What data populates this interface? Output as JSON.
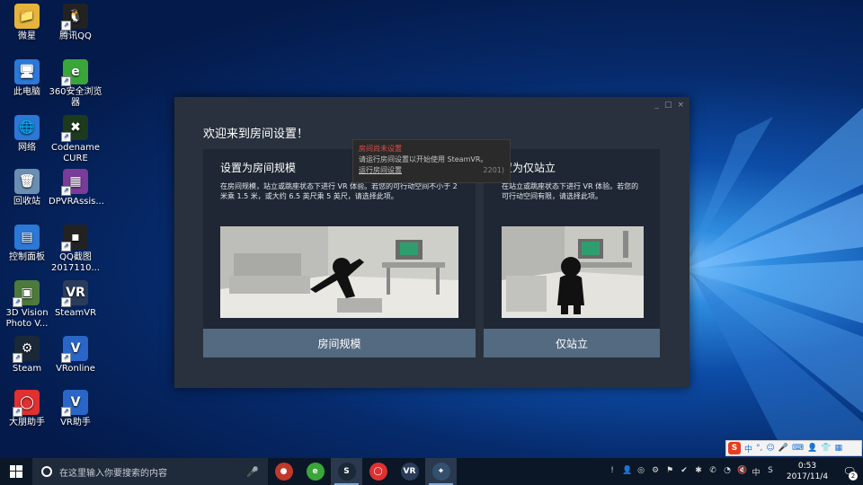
{
  "desktop": {
    "icons": [
      {
        "label": "微星",
        "glyph": "📁",
        "color": "#e7b43b"
      },
      {
        "label": "腾讯QQ",
        "glyph": "🐧",
        "color": "#222222"
      },
      {
        "label": "此电脑",
        "glyph": "🖥",
        "color": "#2b78d6"
      },
      {
        "label": "360安全浏览器",
        "glyph": "e",
        "color": "#3aa63a"
      },
      {
        "label": "网络",
        "glyph": "🌐",
        "color": "#2b78d6"
      },
      {
        "label": "Codename CURE",
        "glyph": "✖",
        "color": "#1d3a1d"
      },
      {
        "label": "回收站",
        "glyph": "🗑",
        "color": "#6b8fb3"
      },
      {
        "label": "DPVRAssis...",
        "glyph": "▦",
        "color": "#7a3b9a"
      },
      {
        "label": "控制面板",
        "glyph": "▤",
        "color": "#2b78d6"
      },
      {
        "label": "QQ截图 2017110...",
        "glyph": "▪",
        "color": "#222222"
      },
      {
        "label": "3D Vision Photo V...",
        "glyph": "▣",
        "color": "#4d7a3a"
      },
      {
        "label": "SteamVR",
        "glyph": "VR",
        "color": "#2a3c5a"
      },
      {
        "label": "Steam",
        "glyph": "⚙",
        "color": "#1b2838"
      },
      {
        "label": "VRonline",
        "glyph": "V",
        "color": "#2a66c8"
      },
      {
        "label": "大朋助手",
        "glyph": "◯",
        "color": "#e03030"
      },
      {
        "label": "VR助手",
        "glyph": "V",
        "color": "#2a66c8"
      }
    ]
  },
  "window": {
    "controls": [
      "_",
      "□",
      "×"
    ],
    "title": "欢迎来到房间设置！",
    "left_panel": {
      "heading": "设置为房间规模",
      "description": "在房间规模，站立或跳座状态下进行 VR 体验。若您的可行动空间不小于 2 米乘 1.5 米，或大约 6.5 英尺乘 5 英尺，请选择此项。",
      "button": "房间规模"
    },
    "right_panel": {
      "heading": "置为仅站立",
      "description": "在站立或跳座状态下进行 VR 体验。若您的可行动空间有限，请选择此项。",
      "button": "仅站立"
    },
    "tooltip": {
      "heading": "房间尚未设置",
      "body": "请运行房间设置以开始使用 SteamVR。",
      "link": "运行房间设置",
      "suffix": "2201)"
    }
  },
  "ime_bar": {
    "logo": "S",
    "items": [
      "中",
      "°,",
      "☺",
      "🎤",
      "⌨",
      "👤",
      "👕",
      "▦"
    ]
  },
  "taskbar": {
    "search_placeholder": "在这里输入你要搜索的内容",
    "apps": [
      {
        "name": "taskbar-app-game",
        "glyph": "●",
        "color": "#c0392b",
        "active": false
      },
      {
        "name": "taskbar-app-360-browser",
        "glyph": "e",
        "color": "#3aa63a",
        "active": false
      },
      {
        "name": "taskbar-app-steam",
        "glyph": "S",
        "color": "#1b2838",
        "active": true
      },
      {
        "name": "taskbar-app-dapeng",
        "glyph": "◯",
        "color": "#e03030",
        "active": false
      },
      {
        "name": "taskbar-app-steamvr",
        "glyph": "VR",
        "color": "#2a3c5a",
        "active": false
      },
      {
        "name": "taskbar-app-roomsetup",
        "glyph": "⌖",
        "color": "#33506e",
        "active": true
      }
    ],
    "tray_icons": [
      "!",
      "👤",
      "◎",
      "⚙",
      "⚑",
      "✔",
      "✱",
      "✆",
      "◔",
      "🔇",
      "中",
      "S"
    ],
    "clock_time": "0:53",
    "clock_date": "2017/11/4",
    "notification_count": "2"
  }
}
